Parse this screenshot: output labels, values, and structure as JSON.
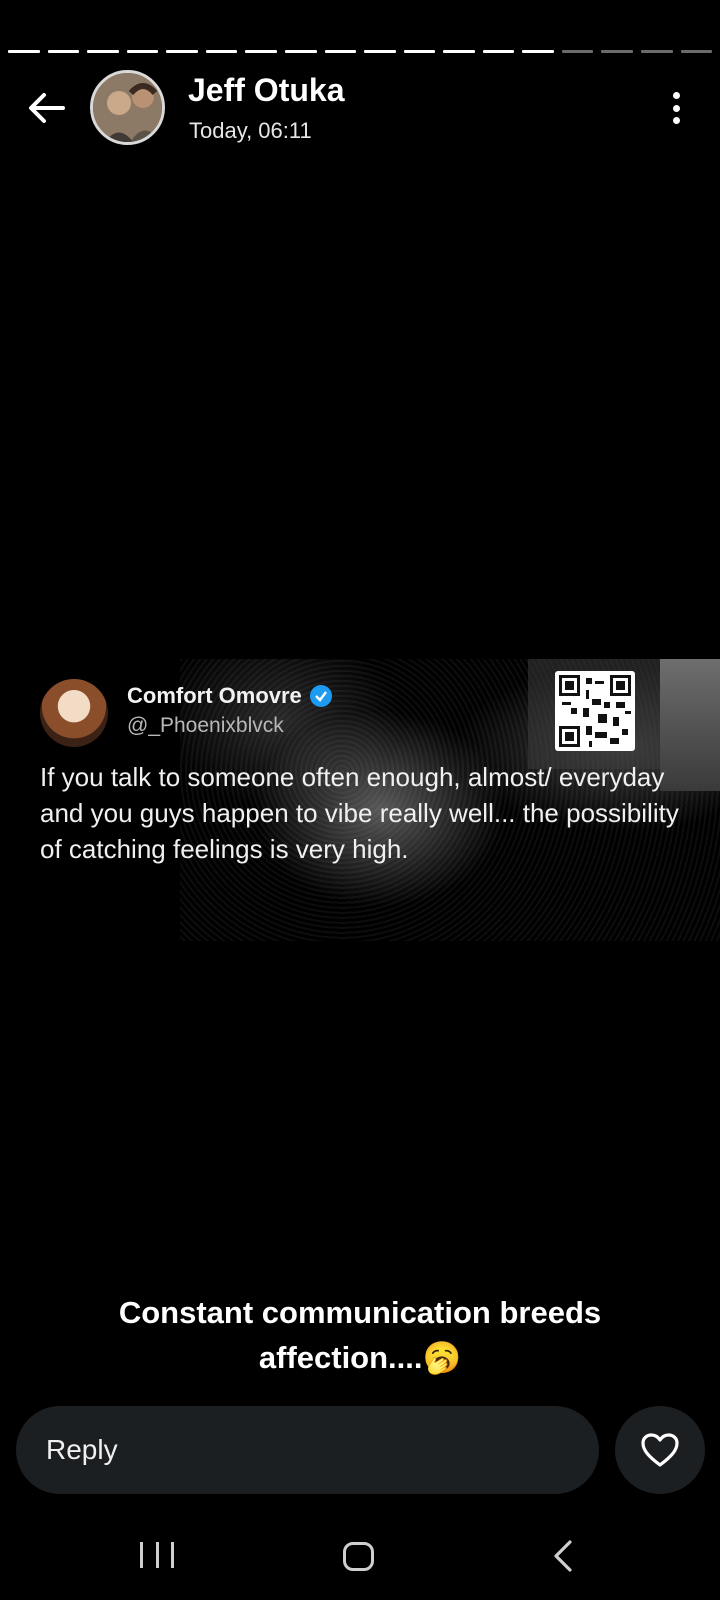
{
  "story": {
    "segments_total": 18,
    "segments_viewed": 14
  },
  "header": {
    "name": "Jeff Otuka",
    "timestamp": "Today, 06:11",
    "back_icon": "arrow-left-icon",
    "menu_icon": "more-vert-icon"
  },
  "tweet": {
    "author": "Comfort Omovre",
    "handle": "@_Phoenixblvck",
    "verified": true,
    "text": "If you talk to someone often enough, almost/ everyday and you guys happen to vibe really well... the possibility of catching feelings is very high.",
    "qr_icon": "qr-code-icon"
  },
  "caption": {
    "text": "Constant communication breeds affection....🥱"
  },
  "reply": {
    "placeholder": "Reply",
    "like_icon": "heart-icon"
  },
  "nav": {
    "recent_icon": "recent-apps-icon",
    "home_icon": "home-icon",
    "back_icon": "back-icon"
  },
  "colors": {
    "background": "#000000",
    "reply_bg": "#1c1f21",
    "verified_blue": "#1d9bf0",
    "progress_done": "#ffffff",
    "progress_pending": "#6b6b6b"
  }
}
